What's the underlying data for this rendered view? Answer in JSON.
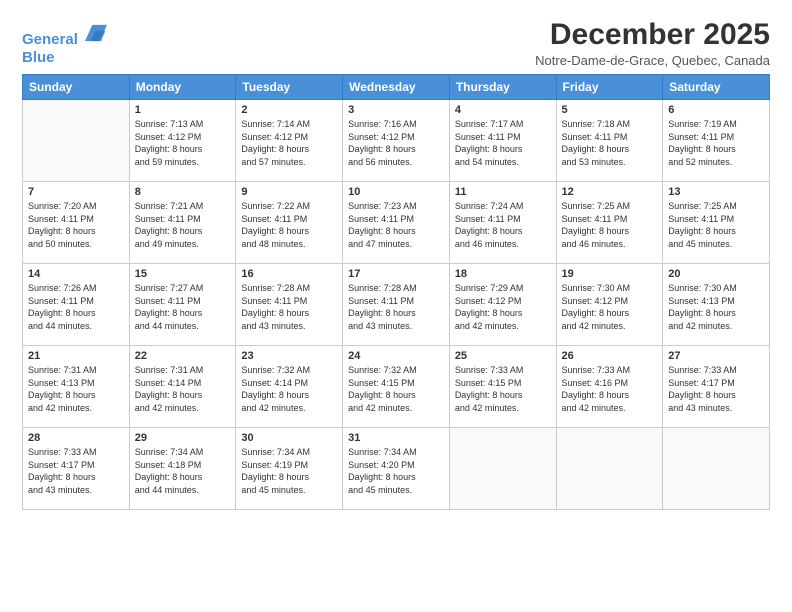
{
  "header": {
    "logo_line1": "General",
    "logo_line2": "Blue",
    "title": "December 2025",
    "subtitle": "Notre-Dame-de-Grace, Quebec, Canada"
  },
  "weekdays": [
    "Sunday",
    "Monday",
    "Tuesday",
    "Wednesday",
    "Thursday",
    "Friday",
    "Saturday"
  ],
  "weeks": [
    [
      {
        "day": "",
        "info": ""
      },
      {
        "day": "1",
        "info": "Sunrise: 7:13 AM\nSunset: 4:12 PM\nDaylight: 8 hours\nand 59 minutes."
      },
      {
        "day": "2",
        "info": "Sunrise: 7:14 AM\nSunset: 4:12 PM\nDaylight: 8 hours\nand 57 minutes."
      },
      {
        "day": "3",
        "info": "Sunrise: 7:16 AM\nSunset: 4:12 PM\nDaylight: 8 hours\nand 56 minutes."
      },
      {
        "day": "4",
        "info": "Sunrise: 7:17 AM\nSunset: 4:11 PM\nDaylight: 8 hours\nand 54 minutes."
      },
      {
        "day": "5",
        "info": "Sunrise: 7:18 AM\nSunset: 4:11 PM\nDaylight: 8 hours\nand 53 minutes."
      },
      {
        "day": "6",
        "info": "Sunrise: 7:19 AM\nSunset: 4:11 PM\nDaylight: 8 hours\nand 52 minutes."
      }
    ],
    [
      {
        "day": "7",
        "info": "Sunrise: 7:20 AM\nSunset: 4:11 PM\nDaylight: 8 hours\nand 50 minutes."
      },
      {
        "day": "8",
        "info": "Sunrise: 7:21 AM\nSunset: 4:11 PM\nDaylight: 8 hours\nand 49 minutes."
      },
      {
        "day": "9",
        "info": "Sunrise: 7:22 AM\nSunset: 4:11 PM\nDaylight: 8 hours\nand 48 minutes."
      },
      {
        "day": "10",
        "info": "Sunrise: 7:23 AM\nSunset: 4:11 PM\nDaylight: 8 hours\nand 47 minutes."
      },
      {
        "day": "11",
        "info": "Sunrise: 7:24 AM\nSunset: 4:11 PM\nDaylight: 8 hours\nand 46 minutes."
      },
      {
        "day": "12",
        "info": "Sunrise: 7:25 AM\nSunset: 4:11 PM\nDaylight: 8 hours\nand 46 minutes."
      },
      {
        "day": "13",
        "info": "Sunrise: 7:25 AM\nSunset: 4:11 PM\nDaylight: 8 hours\nand 45 minutes."
      }
    ],
    [
      {
        "day": "14",
        "info": "Sunrise: 7:26 AM\nSunset: 4:11 PM\nDaylight: 8 hours\nand 44 minutes."
      },
      {
        "day": "15",
        "info": "Sunrise: 7:27 AM\nSunset: 4:11 PM\nDaylight: 8 hours\nand 44 minutes."
      },
      {
        "day": "16",
        "info": "Sunrise: 7:28 AM\nSunset: 4:11 PM\nDaylight: 8 hours\nand 43 minutes."
      },
      {
        "day": "17",
        "info": "Sunrise: 7:28 AM\nSunset: 4:11 PM\nDaylight: 8 hours\nand 43 minutes."
      },
      {
        "day": "18",
        "info": "Sunrise: 7:29 AM\nSunset: 4:12 PM\nDaylight: 8 hours\nand 42 minutes."
      },
      {
        "day": "19",
        "info": "Sunrise: 7:30 AM\nSunset: 4:12 PM\nDaylight: 8 hours\nand 42 minutes."
      },
      {
        "day": "20",
        "info": "Sunrise: 7:30 AM\nSunset: 4:13 PM\nDaylight: 8 hours\nand 42 minutes."
      }
    ],
    [
      {
        "day": "21",
        "info": "Sunrise: 7:31 AM\nSunset: 4:13 PM\nDaylight: 8 hours\nand 42 minutes."
      },
      {
        "day": "22",
        "info": "Sunrise: 7:31 AM\nSunset: 4:14 PM\nDaylight: 8 hours\nand 42 minutes."
      },
      {
        "day": "23",
        "info": "Sunrise: 7:32 AM\nSunset: 4:14 PM\nDaylight: 8 hours\nand 42 minutes."
      },
      {
        "day": "24",
        "info": "Sunrise: 7:32 AM\nSunset: 4:15 PM\nDaylight: 8 hours\nand 42 minutes."
      },
      {
        "day": "25",
        "info": "Sunrise: 7:33 AM\nSunset: 4:15 PM\nDaylight: 8 hours\nand 42 minutes."
      },
      {
        "day": "26",
        "info": "Sunrise: 7:33 AM\nSunset: 4:16 PM\nDaylight: 8 hours\nand 42 minutes."
      },
      {
        "day": "27",
        "info": "Sunrise: 7:33 AM\nSunset: 4:17 PM\nDaylight: 8 hours\nand 43 minutes."
      }
    ],
    [
      {
        "day": "28",
        "info": "Sunrise: 7:33 AM\nSunset: 4:17 PM\nDaylight: 8 hours\nand 43 minutes."
      },
      {
        "day": "29",
        "info": "Sunrise: 7:34 AM\nSunset: 4:18 PM\nDaylight: 8 hours\nand 44 minutes."
      },
      {
        "day": "30",
        "info": "Sunrise: 7:34 AM\nSunset: 4:19 PM\nDaylight: 8 hours\nand 45 minutes."
      },
      {
        "day": "31",
        "info": "Sunrise: 7:34 AM\nSunset: 4:20 PM\nDaylight: 8 hours\nand 45 minutes."
      },
      {
        "day": "",
        "info": ""
      },
      {
        "day": "",
        "info": ""
      },
      {
        "day": "",
        "info": ""
      }
    ]
  ]
}
